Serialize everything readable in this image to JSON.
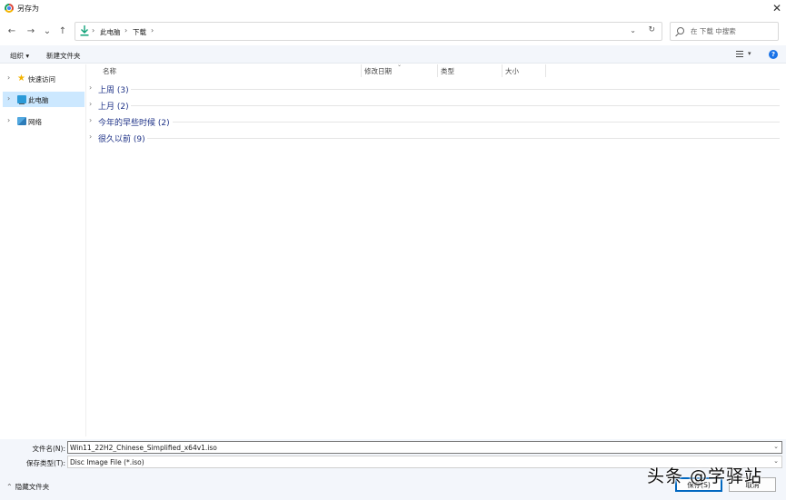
{
  "window": {
    "title": "另存为",
    "close_glyph": "✕"
  },
  "nav": {
    "back_glyph": "←",
    "forward_glyph": "→",
    "recent_glyph": "⌄",
    "up_glyph": "↑",
    "breadcrumb": [
      "此电脑",
      "下载"
    ],
    "chevron_glyph": "›",
    "dropdown_glyph": "⌄",
    "refresh_glyph": "↻",
    "search_placeholder": "在 下载 中搜索"
  },
  "toolbar": {
    "organize_label": "组织 ▾",
    "new_folder_label": "新建文件夹",
    "view_drop_glyph": "▾",
    "help_glyph": "?"
  },
  "sidebar": {
    "items": [
      {
        "label": "快速访问",
        "icon": "star-icon",
        "selected": false
      },
      {
        "label": "此电脑",
        "icon": "computer-icon",
        "selected": true
      },
      {
        "label": "网络",
        "icon": "network-icon",
        "selected": false
      }
    ]
  },
  "columns": {
    "name": "名称",
    "date": "修改日期",
    "type": "类型",
    "size": "大小"
  },
  "groups": [
    {
      "label": "上周 (3)"
    },
    {
      "label": "上月 (2)"
    },
    {
      "label": "今年的早些时候 (2)"
    },
    {
      "label": "很久以前 (9)"
    }
  ],
  "footer": {
    "filename_label": "文件名(N):",
    "filename_value": "Win11_22H2_Chinese_Simplified_x64v1.iso",
    "filetype_label": "保存类型(T):",
    "filetype_value": "Disc Image File (*.iso)",
    "hide_folders_label": "隐藏文件夹",
    "save_label": "保存(S)",
    "cancel_label": "取消"
  },
  "watermark": "头条 @学驿站",
  "colors": {
    "accent": "#0067c0",
    "selected_bg": "#cce8ff",
    "group_text": "#1e3287",
    "download_icon": "#12a37a"
  }
}
